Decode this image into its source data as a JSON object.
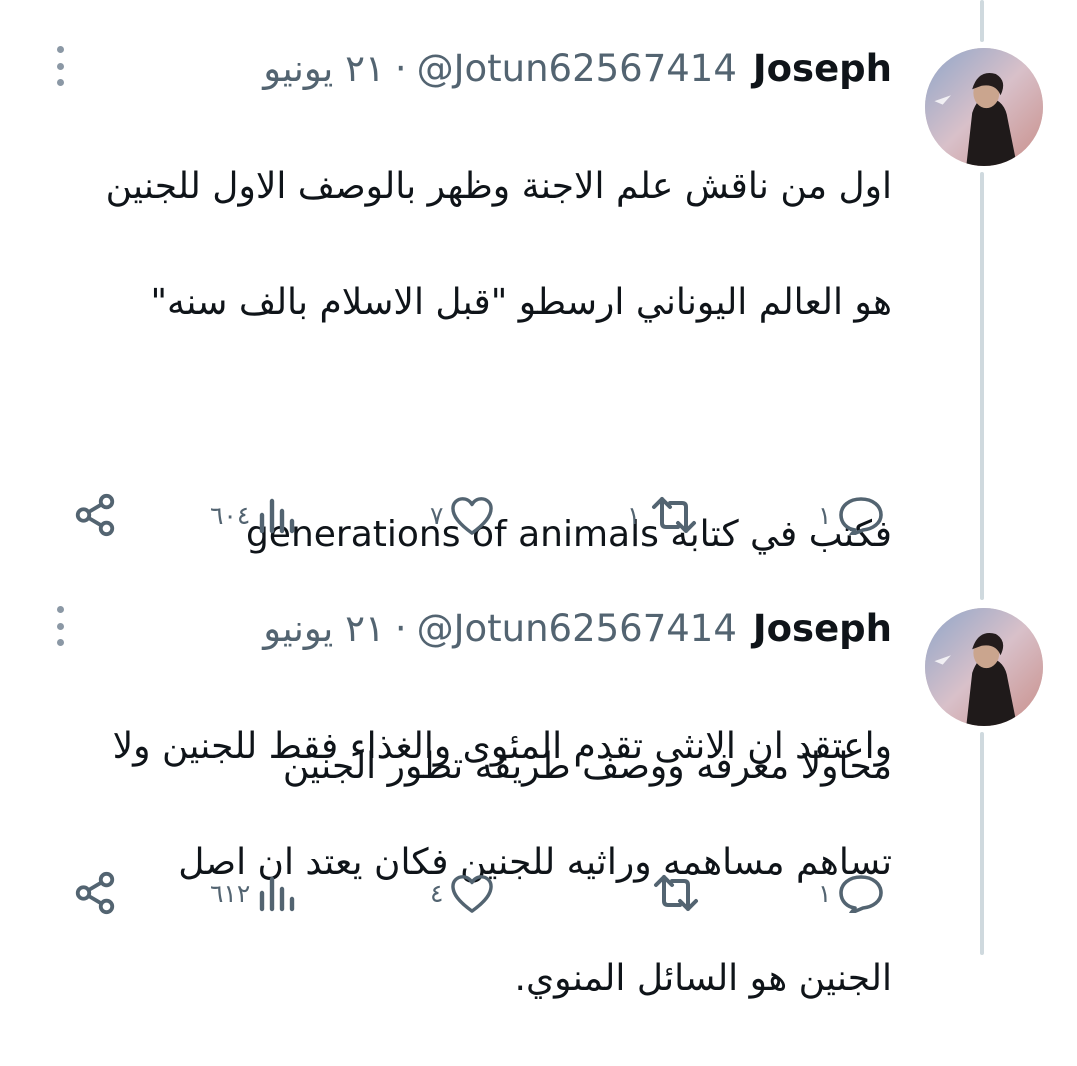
{
  "tweets": [
    {
      "author": {
        "name": "Joseph",
        "handle": "@Jotun62567414"
      },
      "separator": "·",
      "date": "٢١ يونيو",
      "lines": [
        "اول من ناقش علم الاجنة وظهر بالوصف الاول للجنين",
        "هو العالم اليوناني ارسطو \"قبل الاسلام بالف سنه\"",
        "",
        "فكتب في كتابه generations of animals",
        "",
        "محاولا معرفه ووصف طريقه تطور الجنين"
      ],
      "actions": {
        "reply": "١",
        "retweet": "١",
        "like": "٧",
        "views": "٦٠٤"
      }
    },
    {
      "author": {
        "name": "Joseph",
        "handle": "@Jotun62567414"
      },
      "separator": "·",
      "date": "٢١ يونيو",
      "lines": [
        "واعتقد ان الانثى تقدم المئوى والغذاء فقط للجنين ولا",
        "تساهم مساهمه وراثيه للجنين فكان يعتد ان اصل",
        "الجنين هو السائل المنوي."
      ],
      "actions": {
        "reply": "١",
        "retweet": "",
        "like": "٤",
        "views": "٦١٢"
      }
    }
  ],
  "icons": [
    "more-vertical-icon",
    "reply-icon",
    "retweet-icon",
    "like-icon",
    "views-icon",
    "share-icon"
  ],
  "colors": {
    "text": "#0f1419",
    "secondary": "#536471",
    "thread_line": "#cfd9de"
  }
}
